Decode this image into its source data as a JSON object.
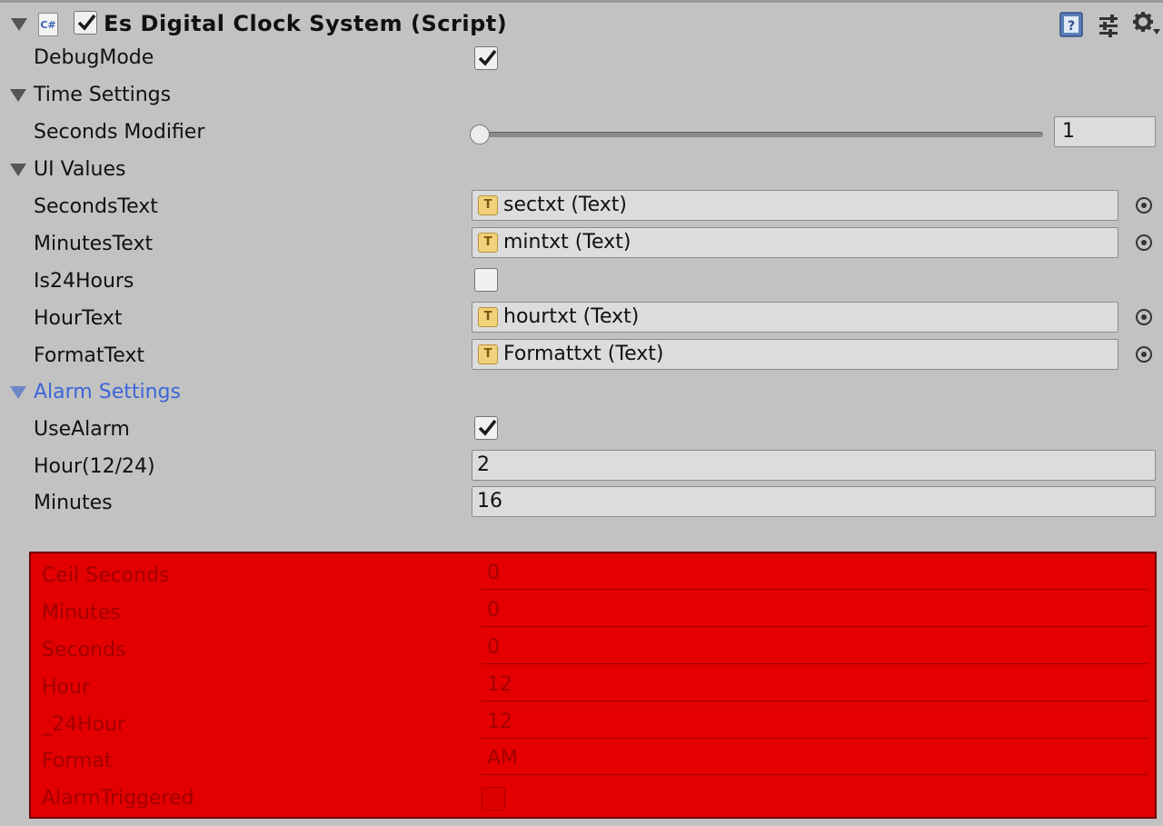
{
  "header": {
    "script_icon_text": "C#",
    "title": "Es Digital Clock System (Script)",
    "enabled": true
  },
  "debug_mode": {
    "label": "DebugMode",
    "checked": true
  },
  "time_settings": {
    "label": "Time Settings",
    "seconds_modifier": {
      "label": "Seconds Modifier",
      "value": "1",
      "slider_fraction": 0.0
    }
  },
  "ui_values": {
    "label": "UI Values",
    "seconds_text": {
      "label": "SecondsText",
      "value": "sectxt (Text)"
    },
    "minutes_text": {
      "label": "MinutesText",
      "value": "mintxt (Text)"
    },
    "is24hours": {
      "label": "Is24Hours",
      "checked": false
    },
    "hour_text": {
      "label": "HourText",
      "value": "hourtxt (Text)"
    },
    "format_text": {
      "label": "FormatText",
      "value": "Formattxt (Text)"
    }
  },
  "alarm_settings": {
    "label": "Alarm Settings",
    "use_alarm": {
      "label": "UseAlarm",
      "checked": true
    },
    "hour": {
      "label": "Hour(12/24)",
      "value": "2"
    },
    "minutes": {
      "label": "Minutes",
      "value": "16"
    }
  },
  "debug_values": {
    "ceil_seconds": {
      "label": "Ceil Seconds",
      "value": "0"
    },
    "minutes": {
      "label": "Minutes",
      "value": "0"
    },
    "seconds": {
      "label": "Seconds",
      "value": "0"
    },
    "hour": {
      "label": "Hour",
      "value": "12"
    },
    "hour24": {
      "label": "_24Hour",
      "value": "12"
    },
    "format": {
      "label": "Format",
      "value": "AM"
    },
    "alarm_triggered": {
      "label": "AlarmTriggered",
      "checked": false
    }
  },
  "colors": {
    "panel_bg": "#c2c2c2",
    "debug_red": "#e20000",
    "section_active": "#3c66d6"
  },
  "icons": {
    "object_field": "text-component-icon",
    "header_help": "help-book-icon",
    "header_preset": "preset-sliders-icon",
    "header_settings": "gear-icon"
  }
}
